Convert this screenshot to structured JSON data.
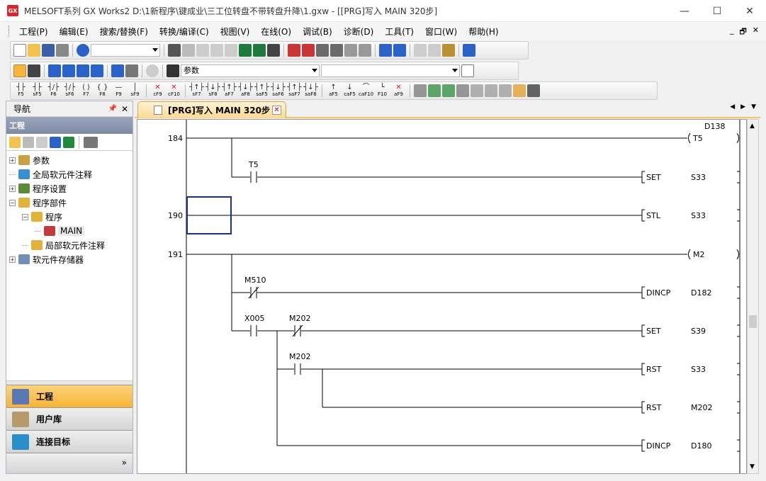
{
  "window": {
    "title": "MELSOFT系列 GX Works2 D:\\1新程序\\键成业\\三工位转盘不带转盘升降\\1.gxw - [[PRG]写入 MAIN 320步]",
    "app_icon_text": "GX",
    "minimize": "—",
    "maximize": "☐",
    "close": "✕"
  },
  "menu": {
    "items": [
      "工程(P)",
      "编辑(E)",
      "搜索/替换(F)",
      "转换/编译(C)",
      "视图(V)",
      "在线(O)",
      "调试(B)",
      "诊断(D)",
      "工具(T)",
      "窗口(W)",
      "帮助(H)"
    ],
    "mdi_min": "_",
    "mdi_restore": "🗗",
    "mdi_close": "✕"
  },
  "toolbar2": {
    "param_combo": "参数",
    "combo2": ""
  },
  "fkeys": [
    {
      "sym": "┤├",
      "label": "F5"
    },
    {
      "sym": "┤├",
      "label": "sF5"
    },
    {
      "sym": "┤/├",
      "label": "F6"
    },
    {
      "sym": "┤/├",
      "label": "sF6"
    },
    {
      "sym": "⟨ ⟩",
      "label": "F7"
    },
    {
      "sym": "{ }",
      "label": "F8"
    },
    {
      "sym": "—",
      "label": "F9"
    },
    {
      "sym": "│",
      "label": "sF9"
    },
    {
      "sym": "✕",
      "label": "cF9"
    },
    {
      "sym": "✕",
      "label": "cF10"
    },
    {
      "sym": "┤↑├",
      "label": "sF7"
    },
    {
      "sym": "┤↓├",
      "label": "sF8"
    },
    {
      "sym": "┤↑├",
      "label": "aF7"
    },
    {
      "sym": "┤↓├",
      "label": "aF8"
    },
    {
      "sym": "┤↑├",
      "label": "saF5"
    },
    {
      "sym": "┤↓├",
      "label": "saF6"
    },
    {
      "sym": "┤↑├",
      "label": "saF7"
    },
    {
      "sym": "┤↓├",
      "label": "saF8"
    },
    {
      "sym": "↑",
      "label": "aF5"
    },
    {
      "sym": "↓",
      "label": "caF5"
    },
    {
      "sym": "⌒",
      "label": "caF10"
    },
    {
      "sym": "└",
      "label": "F10"
    },
    {
      "sym": "✕",
      "label": "aF9"
    }
  ],
  "nav": {
    "header": "导航",
    "pin": "ᵖ",
    "close": "✕",
    "section": "工程",
    "tree": [
      {
        "label": "参数",
        "expander": "+",
        "level": 0,
        "color": "#c9a043"
      },
      {
        "label": "全局软元件注释",
        "expander": "",
        "level": 0,
        "color": "#3a8fd0"
      },
      {
        "label": "程序设置",
        "expander": "+",
        "level": 0,
        "color": "#5a8a3a"
      },
      {
        "label": "程序部件",
        "expander": "−",
        "level": 0,
        "color": "#e2b23b"
      },
      {
        "label": "程序",
        "expander": "−",
        "level": 1,
        "color": "#e2b23b"
      },
      {
        "label": "MAIN",
        "expander": "",
        "level": 2,
        "color": "#c23a3a"
      },
      {
        "label": "局部软元件注释",
        "expander": "",
        "level": 1,
        "color": "#e2b23b"
      },
      {
        "label": "软元件存储器",
        "expander": "+",
        "level": 0,
        "color": "#6f8fb8"
      }
    ],
    "buttons": [
      "工程",
      "用户库",
      "连接目标"
    ],
    "footer_chevron": "»"
  },
  "tab": {
    "label": "[PRG]写入 MAIN 320步",
    "close": "✕",
    "nav_left": "◀",
    "nav_right": "▶",
    "nav_menu": "▼"
  },
  "ladder": {
    "step_numbers": [
      "184",
      "190",
      "191"
    ],
    "contacts": [
      {
        "label": "T5",
        "kind": "NO"
      },
      {
        "label": "M510",
        "kind": "NC"
      },
      {
        "label": "X005",
        "kind": "NO"
      },
      {
        "label": "M202",
        "kind": "NC"
      },
      {
        "label": "M202",
        "kind": "NO"
      }
    ],
    "coils": [
      {
        "device": "T5",
        "param": "D138"
      },
      {
        "device": "M2",
        "param": ""
      }
    ],
    "instructions": [
      {
        "op": "SET",
        "operand": "S33"
      },
      {
        "op": "STL",
        "operand": "S33"
      },
      {
        "op": "DINCP",
        "operand": "D182"
      },
      {
        "op": "SET",
        "operand": "S39"
      },
      {
        "op": "RST",
        "operand": "S33"
      },
      {
        "op": "RST",
        "operand": "M202"
      },
      {
        "op": "DINCP",
        "operand": "D180"
      }
    ]
  },
  "scrollbar": {
    "up": "▲",
    "down": "▼"
  }
}
